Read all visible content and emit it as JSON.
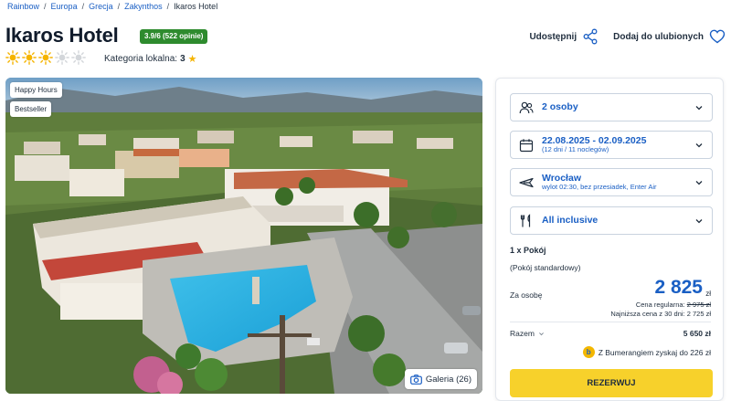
{
  "breadcrumb": [
    {
      "label": "Rainbow"
    },
    {
      "label": "Europa"
    },
    {
      "label": "Grecja"
    },
    {
      "label": "Zakynthos"
    },
    {
      "label": "Ikaros Hotel"
    }
  ],
  "hotel": {
    "name": "Ikaros Hotel",
    "rating_badge": "3.9/6 (522 opinie)",
    "sun_rating": 3,
    "sun_max": 5,
    "local_category_label": "Kategoria lokalna:",
    "local_category_value": "3"
  },
  "actions": {
    "share_label": "Udostępnij",
    "favorite_label": "Dodaj do ulubionych"
  },
  "photo": {
    "tags": [
      "Happy Hours",
      "Bestseller"
    ],
    "gallery_label": "Galeria (26)"
  },
  "booking": {
    "persons": "2 osoby",
    "dates": "22.08.2025 - 02.09.2025",
    "dates_sub": "(12 dni / 11 noclegów)",
    "departure": "Wrocław",
    "departure_sub": "wylot 02:30, bez przesiadek, Enter Air",
    "board": "All inclusive",
    "room_count": "1 x Pokój",
    "room_type": "(Pokój standardowy)",
    "per_person_label": "Za osobę",
    "price_per_person": "2 825",
    "currency": "zł",
    "regular_price_label": "Cena regularna:",
    "regular_price": "2 975 zł",
    "lowest_price_text": "Najniższa cena z 30 dni: 2 725 zł",
    "total_label": "Razem",
    "total_value": "5 650 zł",
    "bumerang_text": "Z Bumerangiem zyskaj do 226 zł",
    "reserve_label": "REZERWUJ"
  },
  "colors": {
    "accent": "#1a5fc4",
    "rating_green": "#2e8b2e",
    "reserve_yellow": "#f7d12b",
    "sun": "#f5b400"
  }
}
